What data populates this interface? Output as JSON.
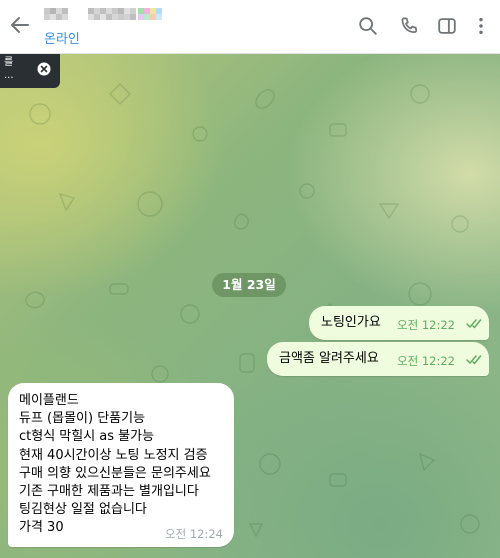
{
  "header": {
    "status": "온라인"
  },
  "toast": {
    "line1": "를",
    "line2": "..."
  },
  "chat": {
    "date": "1월 23일",
    "outgoing": [
      {
        "text": "노팅인가요",
        "time": "오전 12:22"
      },
      {
        "text": "금액좀 알려주세요",
        "time": "오전 12:22"
      }
    ],
    "incoming": {
      "lines": [
        "메이플랜드",
        "듀프 (몹몰이) 단품기능",
        "ct형식 막힐시 as 불가능",
        "현재 40시간이상 노팅 노정지 검증",
        "구매 의향 있으신분들은 문의주세요",
        "기존 구매한 제품과는 별개입니다",
        "팅김현상 일절 없습니다",
        "가격 30"
      ],
      "time": "오전 12:24"
    }
  },
  "colors": {
    "accent": "#3390ec",
    "outgoing_bubble": "#effdde",
    "read_check": "#5fad5d"
  }
}
